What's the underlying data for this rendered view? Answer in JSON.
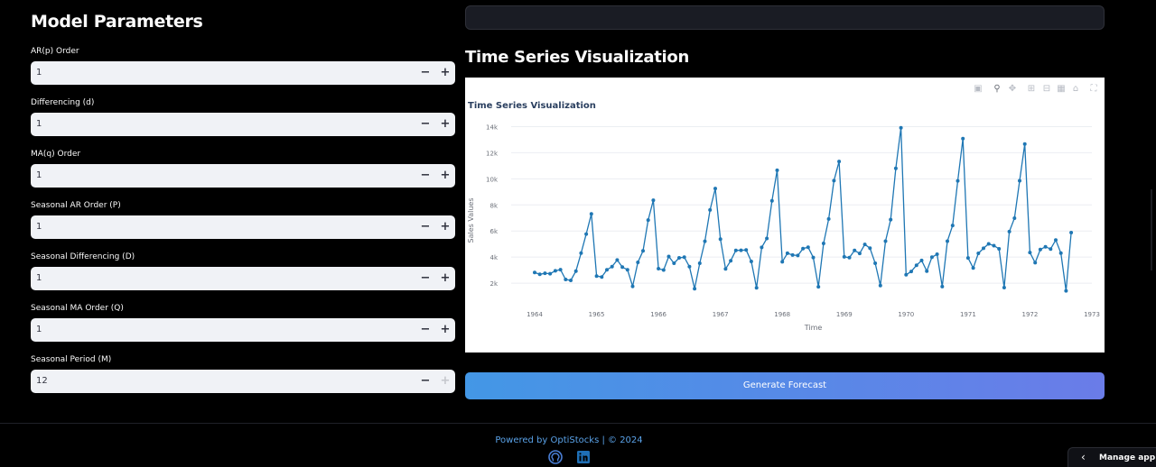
{
  "sidebar": {
    "title": "Model Parameters",
    "params": [
      {
        "label": "AR(p) Order",
        "value": "1"
      },
      {
        "label": "Differencing (d)",
        "value": "1"
      },
      {
        "label": "MA(q) Order",
        "value": "1"
      },
      {
        "label": "Seasonal AR Order (P)",
        "value": "1"
      },
      {
        "label": "Seasonal Differencing (D)",
        "value": "1"
      },
      {
        "label": "Seasonal MA Order (Q)",
        "value": "1"
      },
      {
        "label": "Seasonal Period (M)",
        "value": "12"
      }
    ],
    "minus_symbol": "−",
    "plus_symbol": "+"
  },
  "main": {
    "viz_heading": "Time Series Visualization",
    "generate_button": "Generate Forecast"
  },
  "modebar": {
    "icons": [
      "camera-icon",
      "zoom-icon",
      "pan-icon",
      "zoom-in-icon",
      "zoom-out-icon",
      "autoscale-icon",
      "reset-axes-icon",
      "fullscreen-icon"
    ]
  },
  "chart_data": {
    "type": "line",
    "title": "Time Series Visualization",
    "xlabel": "Time",
    "ylabel": "Sales Values",
    "x_ticks": [
      "1964",
      "1965",
      "1966",
      "1967",
      "1968",
      "1969",
      "1970",
      "1971",
      "1972",
      "1973"
    ],
    "y_ticks": [
      "2k",
      "4k",
      "6k",
      "8k",
      "10k",
      "12k",
      "14k"
    ],
    "xlim": [
      1964,
      1973
    ],
    "ylim": [
      0,
      15000
    ],
    "grid": true,
    "line_color": "#1f77b4",
    "series": [
      {
        "start": "1964-01",
        "frequency": "monthly",
        "values": [
          2815,
          2672,
          2755,
          2721,
          2946,
          3036,
          2282,
          2212,
          2922,
          4301,
          5764,
          7312,
          2541,
          2475,
          3031,
          3266,
          3776,
          3230,
          3028,
          1759,
          3595,
          4474,
          6838,
          8357,
          3113,
          3006,
          4047,
          3523,
          3937,
          3986,
          3260,
          1573,
          3528,
          5211,
          7614,
          9254,
          5375,
          3088,
          3718,
          4514,
          4520,
          4539,
          3663,
          1643,
          4739,
          5428,
          8314,
          10651,
          3633,
          4292,
          4154,
          4121,
          4647,
          4753,
          3965,
          1723,
          5048,
          6922,
          9858,
          11331,
          4016,
          3957,
          4510,
          4276,
          4968,
          4677,
          3523,
          1821,
          5222,
          6872,
          10803,
          13916,
          2639,
          2899,
          3370,
          3740,
          2927,
          3986,
          4217,
          1738,
          5221,
          6424,
          9842,
          13076,
          3934,
          3162,
          4286,
          4676,
          5010,
          4874,
          4633,
          1659,
          5951,
          6981,
          9851,
          12670,
          4348,
          3564,
          4577,
          4788,
          4618,
          5312,
          4298,
          1413,
          5877
        ]
      }
    ]
  },
  "footer": {
    "powered_by": "Powered by OptiStocks | © 2024",
    "github_color": "#4a7fd6",
    "linkedin_color": "#1f6fb5"
  },
  "manage_app": {
    "label": "Manage app"
  }
}
